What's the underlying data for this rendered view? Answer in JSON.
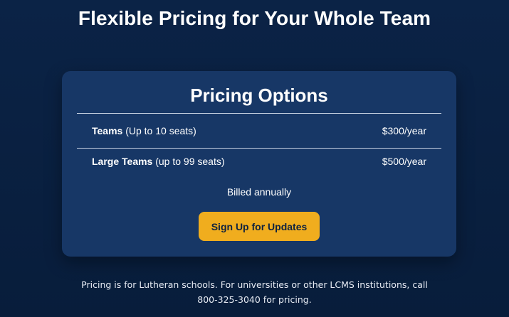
{
  "header": {
    "title": "Flexible Pricing for Your Whole Team"
  },
  "card": {
    "title": "Pricing Options",
    "plans": [
      {
        "name": "Teams",
        "seats": " (Up to 10 seats)",
        "price": "$300/year"
      },
      {
        "name": "Large Teams",
        "seats": " (up to 99 seats)",
        "price": "$500/year"
      }
    ],
    "billing_note": "Billed annually",
    "cta_label": "Sign Up for Updates"
  },
  "footer": {
    "line1": "Pricing is for Lutheran schools. For universities or other LCMS institutions, call",
    "line2": "800-325-3040 for pricing."
  },
  "colors": {
    "background": "#0b2346",
    "card": "#173766",
    "accent": "#f0ad1e"
  }
}
